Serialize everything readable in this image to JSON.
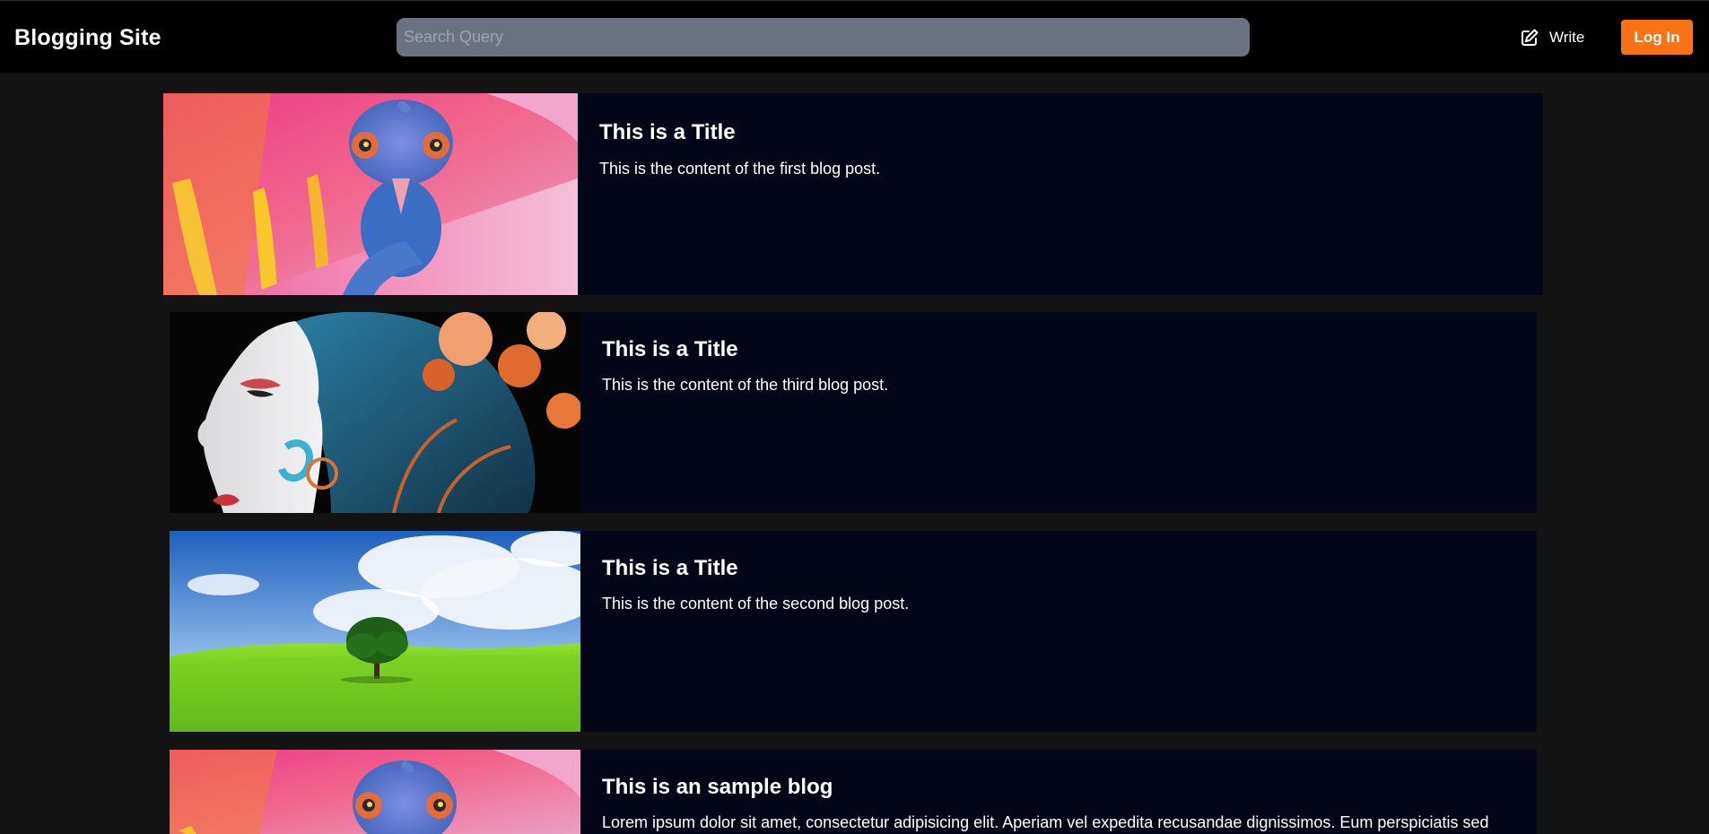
{
  "header": {
    "brand": "Blogging Site",
    "search_placeholder": "Search Query",
    "write_label": "Write",
    "login_label": "Log In"
  },
  "colors": {
    "accent": "#f97316",
    "navbar_bg": "#000000",
    "page_bg": "#131313",
    "card_bg": "#030616",
    "search_bg": "#6b7280"
  },
  "posts": [
    {
      "title": "This is a Title",
      "content": "This is the content of the first blog post.",
      "image": "chameleon-on-flower"
    },
    {
      "title": "This is a Title",
      "content": "This is the content of the third blog post.",
      "image": "woman-with-flower-headdress"
    },
    {
      "title": "This is a Title",
      "content": "This is the content of the second blog post.",
      "image": "tree-on-green-hill"
    },
    {
      "title": "This is an sample blog",
      "content": "Lorem ipsum dolor sit amet, consectetur adipisicing elit. Aperiam vel expedita recusandae dignissimos. Eum perspiciatis sed",
      "image": "chameleon-on-flower"
    }
  ]
}
